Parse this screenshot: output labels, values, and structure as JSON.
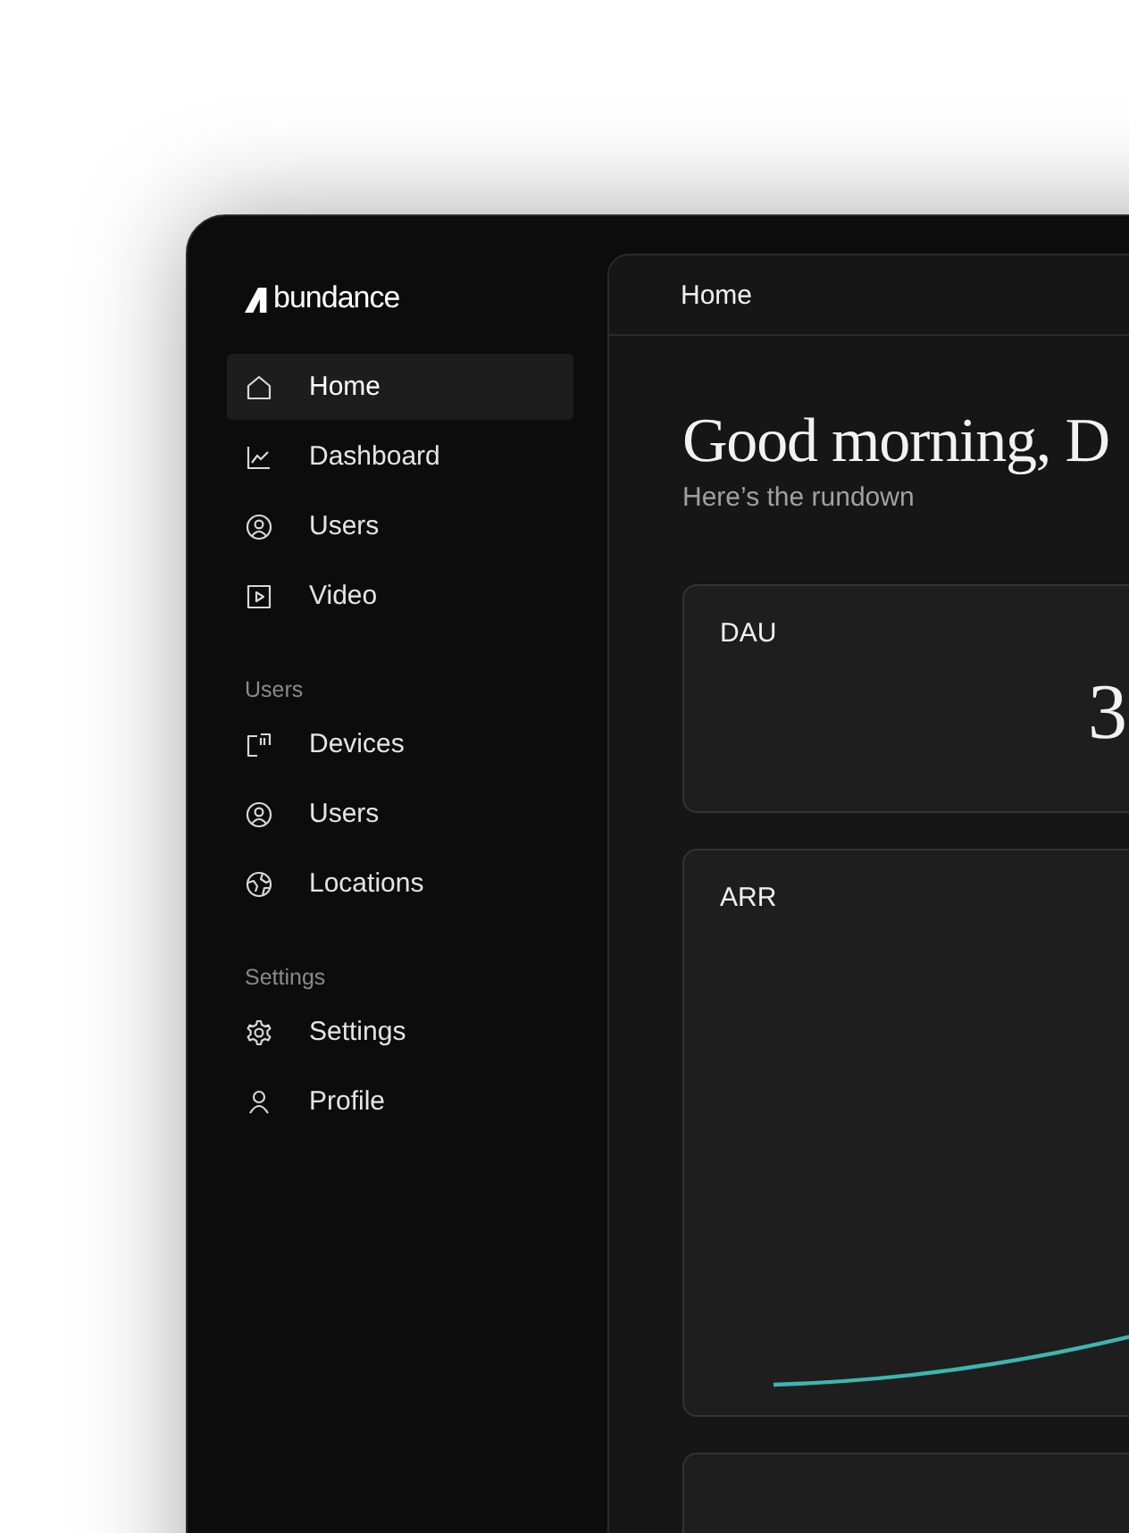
{
  "brand": {
    "name": "bundance"
  },
  "nav": [
    {
      "items": [
        {
          "label": "Home",
          "selected": true
        },
        {
          "label": "Dashboard",
          "selected": false
        },
        {
          "label": "Users",
          "selected": false
        },
        {
          "label": "Video",
          "selected": false
        }
      ]
    },
    {
      "title": "Users",
      "items": [
        {
          "label": "Devices",
          "selected": false
        },
        {
          "label": "Users",
          "selected": false
        },
        {
          "label": "Locations",
          "selected": false
        }
      ]
    },
    {
      "title": "Settings",
      "items": [
        {
          "label": "Settings",
          "selected": false
        },
        {
          "label": "Profile",
          "selected": false
        }
      ]
    }
  ],
  "breadcrumb": "Home",
  "greeting": "Good morning, D",
  "subtitle": "Here’s the rundown",
  "cards": [
    {
      "kind": "stat",
      "label": "DAU",
      "value": "3"
    },
    {
      "kind": "chart",
      "label": "ARR"
    },
    {
      "kind": "blank"
    }
  ]
}
